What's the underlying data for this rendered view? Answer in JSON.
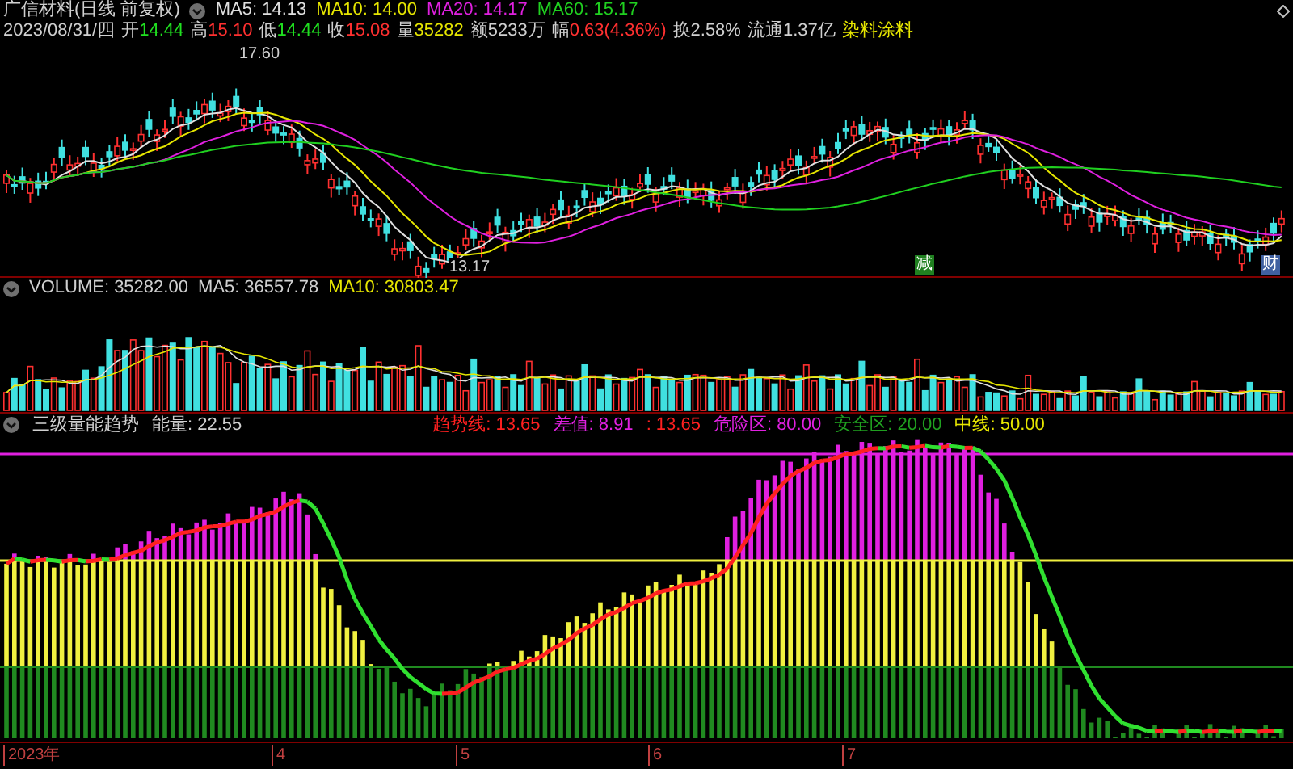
{
  "header": {
    "title": "广信材料(日线 前复权)",
    "moving_averages": [
      {
        "label": "MA5: 14.13",
        "color": "#e0e0e0"
      },
      {
        "label": "MA10: 14.00",
        "color": "#e6e600"
      },
      {
        "label": "MA20: 14.17",
        "color": "#e020e0"
      },
      {
        "label": "MA60: 15.17",
        "color": "#20d020"
      }
    ]
  },
  "quote_line": {
    "date": "2023/08/31/四",
    "fields": [
      {
        "label": "开",
        "value": "14.44",
        "color": "#20e020"
      },
      {
        "label": "高",
        "value": "15.10",
        "color": "#ff3030"
      },
      {
        "label": "低",
        "value": "14.44",
        "color": "#20e020"
      },
      {
        "label": "收",
        "value": "15.08",
        "color": "#ff3030"
      },
      {
        "label": "量",
        "value": "35282",
        "color": "#e6e600"
      },
      {
        "label": "额",
        "value": "5233万",
        "color": "#d0d0d0"
      },
      {
        "label": "幅",
        "value": "0.63(4.36%)",
        "color": "#ff3030"
      },
      {
        "label": "换",
        "value": "2.58%",
        "color": "#d0d0d0"
      },
      {
        "label": "流通",
        "value": "1.37亿",
        "color": "#d0d0d0"
      }
    ],
    "sector": "染料涂料"
  },
  "price_chart": {
    "high_label": "17.60",
    "low_label": "13.17",
    "badges": [
      {
        "text": "减",
        "color": "#208020"
      },
      {
        "text": "财",
        "color": "#4060a0"
      }
    ]
  },
  "volume_panel": {
    "items": [
      {
        "label": "VOLUME: 35282.00",
        "color": "#d0d0d0"
      },
      {
        "label": "MA5: 36557.78",
        "color": "#d0d0d0"
      },
      {
        "label": "MA10: 30803.47",
        "color": "#e6e600"
      }
    ]
  },
  "indicator_panel": {
    "title": "三级量能趋势",
    "items": [
      {
        "label": "能量: 22.55",
        "color": "#d0d0d0"
      },
      {
        "label": "趋势线: 13.65",
        "color": "#ff2020"
      },
      {
        "label": "差值: 8.91",
        "color": "#e020e0"
      },
      {
        "label": ": 13.65",
        "color": "#ff2020"
      },
      {
        "label": "危险区: 80.00",
        "color": "#e020e0"
      },
      {
        "label": "安全区: 20.00",
        "color": "#20a020"
      },
      {
        "label": "中线: 50.00",
        "color": "#e6e600"
      }
    ]
  },
  "time_axis": [
    "2023年",
    "4",
    "5",
    "6",
    "7"
  ]
}
